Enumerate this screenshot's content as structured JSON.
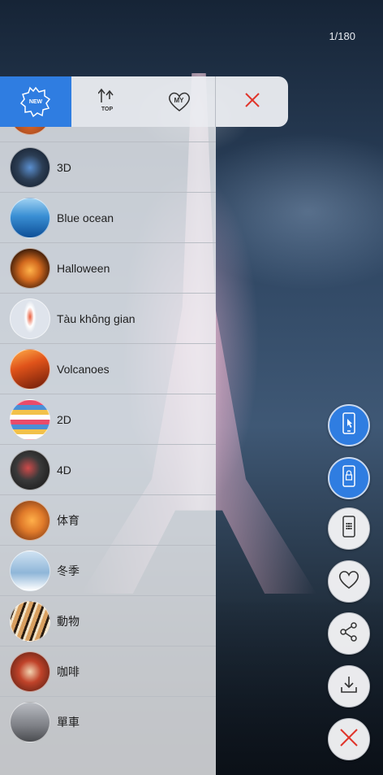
{
  "page_counter": "1/180",
  "toolbar": {
    "new_label": "NEW",
    "top_label": "TOP",
    "my_label": "MY"
  },
  "categories": [
    {
      "label": "",
      "icon": "category-thumb-partial",
      "color": "#c0552a"
    },
    {
      "label": "3D",
      "icon": "category-thumb-3d",
      "color": "#2c3e55"
    },
    {
      "label": "Blue ocean",
      "icon": "category-thumb-blue-ocean",
      "color": "#2e7fc7"
    },
    {
      "label": "Halloween",
      "icon": "category-thumb-halloween",
      "color": "#d2691e"
    },
    {
      "label": "Tàu không gian",
      "icon": "category-thumb-spaceship",
      "color": "#d8dde6"
    },
    {
      "label": "Volcanoes",
      "icon": "category-thumb-volcano",
      "color": "#d8551a"
    },
    {
      "label": "2D",
      "icon": "category-thumb-2d",
      "color": "#c9456a"
    },
    {
      "label": "4D",
      "icon": "category-thumb-4d",
      "color": "#2a2a2a"
    },
    {
      "label": "体育",
      "icon": "category-thumb-sports",
      "color": "#e07a2a"
    },
    {
      "label": "冬季",
      "icon": "category-thumb-winter",
      "color": "#a9c4dc"
    },
    {
      "label": "動物",
      "icon": "category-thumb-animals",
      "color": "#b6864f"
    },
    {
      "label": "咖啡",
      "icon": "category-thumb-coffee",
      "color": "#c0432a"
    },
    {
      "label": "單車",
      "icon": "category-thumb-bicycle",
      "color": "#7d7f85"
    }
  ],
  "colors": {
    "accent": "#2f7de1",
    "close_red": "#e0342a"
  }
}
